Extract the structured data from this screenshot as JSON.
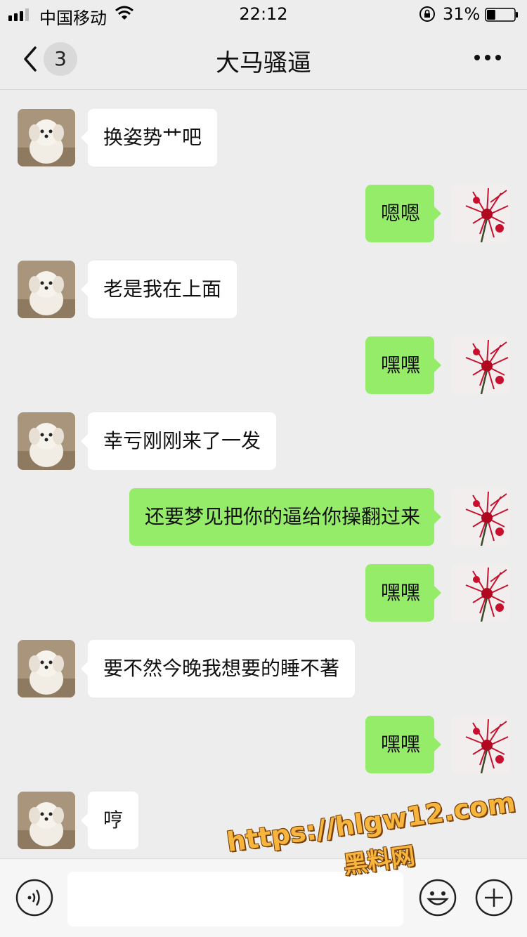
{
  "status_bar": {
    "carrier": "中国移动",
    "time": "22:12",
    "battery_percent": "31%",
    "battery_level": 0.31
  },
  "nav": {
    "unread_count": "3",
    "title": "大马骚逼"
  },
  "messages": [
    {
      "side": "in",
      "text": "换姿势艹吧"
    },
    {
      "side": "out",
      "text": "嗯嗯"
    },
    {
      "side": "in",
      "text": "老是我在上面"
    },
    {
      "side": "out",
      "text": "嘿嘿"
    },
    {
      "side": "in",
      "text": "幸亏刚刚来了一发"
    },
    {
      "side": "out",
      "text": "还要梦见把你的逼给你操翻过来"
    },
    {
      "side": "out",
      "text": "嘿嘿"
    },
    {
      "side": "in",
      "text": "要不然今晚我想要的睡不著"
    },
    {
      "side": "out",
      "text": "嘿嘿"
    },
    {
      "side": "in",
      "text": "哼"
    }
  ],
  "input_bar": {
    "value": ""
  },
  "watermark": {
    "url": "https://hlgw12.com",
    "site_name": "黑料网"
  },
  "colors": {
    "background": "#ededed",
    "outgoing_bubble": "#95ec69",
    "incoming_bubble": "#ffffff"
  },
  "icons": [
    "signal-icon",
    "wifi-icon",
    "orientation-lock-icon",
    "battery-icon",
    "back-chevron-icon",
    "more-dots-icon",
    "voice-icon",
    "emoji-icon",
    "plus-icon"
  ]
}
